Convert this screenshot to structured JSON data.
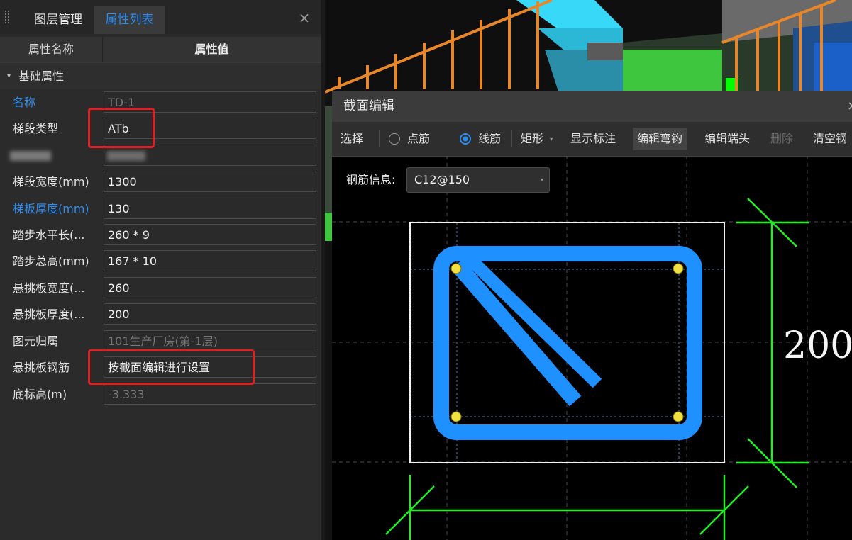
{
  "tabs": {
    "layers": "图层管理",
    "properties": "属性列表",
    "close": "×"
  },
  "columns": {
    "name": "属性名称",
    "value": "属性值"
  },
  "group": {
    "label": "基础属性",
    "caret": "▾"
  },
  "properties": [
    {
      "name": "名称",
      "value": "TD-1",
      "name_color": "blue",
      "value_muted": true
    },
    {
      "name": "梯段类型",
      "value": "ATb",
      "highlighted": true
    },
    {
      "name": "",
      "value": "",
      "obscured": true
    },
    {
      "name": "梯段宽度(mm)",
      "value": "1300"
    },
    {
      "name": "梯板厚度(mm)",
      "value": "130",
      "name_color": "blue"
    },
    {
      "name": "踏步水平长(...",
      "value": "260 * 9"
    },
    {
      "name": "踏步总高(mm)",
      "value": "167 * 10"
    },
    {
      "name": "悬挑板宽度(...",
      "value": "260"
    },
    {
      "name": "悬挑板厚度(...",
      "value": "200"
    },
    {
      "name": "图元归属",
      "value": "101生产厂房(第-1层)",
      "value_muted": true
    },
    {
      "name": "悬挑板钢筋",
      "value": "按截面编辑进行设置",
      "highlighted": true
    },
    {
      "name": "底标高(m)",
      "value": "-3.333",
      "value_muted": true
    }
  ],
  "dialog": {
    "title": "截面编辑",
    "close": "×",
    "toolbar": {
      "select": "选择",
      "point_rebar": "点筋",
      "line_rebar": "线筋",
      "rect": "矩形",
      "rect_caret": "▾",
      "show_dims": "显示标注",
      "edit_hook": "编辑弯钩",
      "edit_end": "编辑端头",
      "delete": "删除",
      "clear": "清空钢"
    },
    "selected_mode": "line_rebar",
    "rebar_info_label": "钢筋信息:",
    "rebar_info_value": "C12@150",
    "rebar_caret": "▾",
    "dimension_text": "200"
  },
  "colors": {
    "accent_blue": "#2d8cf0",
    "highlight_red": "#e02020",
    "rebar_blue": "#1e90ff",
    "dimension_green": "#22ee22",
    "rail_orange": "#e8862a",
    "stair_cyan": "#38d8f8",
    "node_yellow": "#f0e040"
  }
}
